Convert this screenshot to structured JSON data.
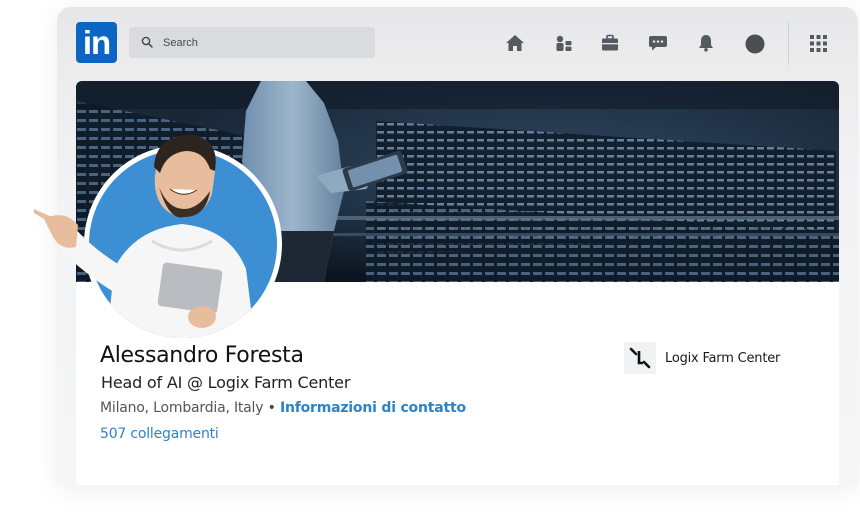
{
  "header": {
    "logo_text": "in",
    "search": {
      "placeholder": "Search"
    },
    "icons": [
      "home-icon",
      "people-icon",
      "briefcase-icon",
      "chat-icon",
      "bell-icon",
      "profile-avatar",
      "apps-grid-icon"
    ]
  },
  "profile": {
    "name": "Alessandro Foresta",
    "headline": "Head of AI @ Logix Farm Center",
    "location": "Milano, Lombardia, Italy",
    "separator": "•",
    "contact_link": "Informazioni di contatto",
    "connections": "507 collegamenti",
    "company": {
      "name": "Logix Farm Center"
    }
  },
  "colors": {
    "brand_blue": "#0a66c2",
    "link_blue": "#2d83c8",
    "avatar_bg": "#3d8fd3"
  }
}
